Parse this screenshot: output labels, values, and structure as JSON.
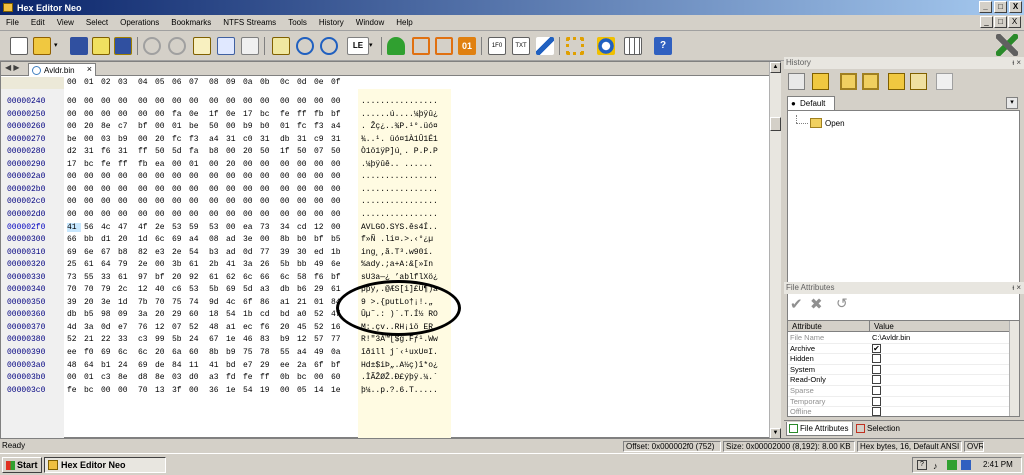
{
  "window": {
    "title": "Hex Editor Neo",
    "btn_min": "_",
    "btn_max": "□",
    "btn_close": "X"
  },
  "menu": [
    "File",
    "Edit",
    "View",
    "Select",
    "Operations",
    "Bookmarks",
    "NTFS Streams",
    "Tools",
    "History",
    "Window",
    "Help"
  ],
  "mdi_buttons": [
    "_",
    "□",
    "X"
  ],
  "toolbar": {
    "endian_label": "LE",
    "colors": {
      "green": "#2a9a2a",
      "orange": "#e07010",
      "blue": "#2060c0",
      "yellow": "#e0b000",
      "red": "#c02020"
    }
  },
  "editor": {
    "nav_arrows": "◀ ▶",
    "tab_label": "Avldr.bin",
    "tab_close": "×",
    "header": [
      "00",
      "01",
      "02",
      "03",
      "04",
      "05",
      "06",
      "07",
      "08",
      "09",
      "0a",
      "0b",
      "0c",
      "0d",
      "0e",
      "0f"
    ],
    "rows": [
      {
        "addr": "00000240",
        "hex": [
          "00",
          "00",
          "00",
          "00",
          "00",
          "00",
          "00",
          "00",
          "00",
          "00",
          "00",
          "00",
          "00",
          "00",
          "00",
          "00"
        ],
        "ascii": "................"
      },
      {
        "addr": "00000250",
        "hex": [
          "00",
          "00",
          "00",
          "00",
          "00",
          "00",
          "fa",
          "0e",
          "1f",
          "0e",
          "17",
          "bc",
          "fe",
          "ff",
          "fb",
          "bf"
        ],
        "ascii": "......ú....¼þÿû¿"
      },
      {
        "addr": "00000260",
        "hex": [
          "00",
          "20",
          "8e",
          "c7",
          "bf",
          "00",
          "01",
          "be",
          "50",
          "00",
          "b9",
          "b0",
          "01",
          "fc",
          "f3",
          "a4"
        ],
        "ascii": ". Žç¿..¾P.¹°.üó¤"
      },
      {
        "addr": "00000270",
        "hex": [
          "be",
          "00",
          "03",
          "b9",
          "00",
          "20",
          "fc",
          "f3",
          "a4",
          "31",
          "c0",
          "31",
          "db",
          "31",
          "c9",
          "31"
        ],
        "ascii": "¾..¹. üó¤1À1Û1É1"
      },
      {
        "addr": "00000280",
        "hex": [
          "d2",
          "31",
          "f6",
          "31",
          "ff",
          "50",
          "5d",
          "fa",
          "b8",
          "00",
          "20",
          "50",
          "1f",
          "50",
          "07",
          "50"
        ],
        "ascii": "Ò1ö1ÿP]ú¸. P.P.P"
      },
      {
        "addr": "00000290",
        "hex": [
          "17",
          "bc",
          "fe",
          "ff",
          "fb",
          "ea",
          "00",
          "01",
          "00",
          "20",
          "00",
          "00",
          "00",
          "00",
          "00",
          "00"
        ],
        "ascii": ".¼þÿûê.. ......"
      },
      {
        "addr": "000002a0",
        "hex": [
          "00",
          "00",
          "00",
          "00",
          "00",
          "00",
          "00",
          "00",
          "00",
          "00",
          "00",
          "00",
          "00",
          "00",
          "00",
          "00"
        ],
        "ascii": "................"
      },
      {
        "addr": "000002b0",
        "hex": [
          "00",
          "00",
          "00",
          "00",
          "00",
          "00",
          "00",
          "00",
          "00",
          "00",
          "00",
          "00",
          "00",
          "00",
          "00",
          "00"
        ],
        "ascii": "................"
      },
      {
        "addr": "000002c0",
        "hex": [
          "00",
          "00",
          "00",
          "00",
          "00",
          "00",
          "00",
          "00",
          "00",
          "00",
          "00",
          "00",
          "00",
          "00",
          "00",
          "00"
        ],
        "ascii": "................"
      },
      {
        "addr": "000002d0",
        "hex": [
          "00",
          "00",
          "00",
          "00",
          "00",
          "00",
          "00",
          "00",
          "00",
          "00",
          "00",
          "00",
          "00",
          "00",
          "00",
          "00"
        ],
        "ascii": "................"
      },
      {
        "addr": "000002f0",
        "hex": [
          "41",
          "56",
          "4c",
          "47",
          "4f",
          "2e",
          "53",
          "59",
          "53",
          "00",
          "ea",
          "73",
          "34",
          "cd",
          "12",
          "00"
        ],
        "ascii": "AVLGO.SYS.ês4Í.."
      },
      {
        "addr": "00000300",
        "hex": [
          "66",
          "bb",
          "d1",
          "20",
          "1d",
          "6c",
          "69",
          "a4",
          "08",
          "ad",
          "3e",
          "00",
          "8b",
          "b0",
          "bf",
          "b5"
        ],
        "ascii": "f»Ñ .li¤.­>.‹°¿µ"
      },
      {
        "addr": "00000310",
        "hex": [
          "69",
          "6e",
          "67",
          "b8",
          "82",
          "e3",
          "2e",
          "54",
          "b3",
          "ad",
          "0d",
          "77",
          "39",
          "30",
          "ed",
          "1b"
        ],
        "ascii": "ing¸‚ã.T³­.w90í."
      },
      {
        "addr": "00000320",
        "hex": [
          "25",
          "61",
          "64",
          "79",
          "2e",
          "00",
          "3b",
          "61",
          "2b",
          "41",
          "3a",
          "26",
          "5b",
          "bb",
          "49",
          "6e"
        ],
        "ascii": "%ady.;a+A:&[»In"
      },
      {
        "addr": "00000330",
        "hex": [
          "73",
          "55",
          "33",
          "61",
          "97",
          "bf",
          "20",
          "92",
          "61",
          "62",
          "6c",
          "66",
          "6c",
          "58",
          "f6",
          "bf"
        ],
        "ascii": "sU3a—¿ ’ablflXö¿"
      },
      {
        "addr": "00000340",
        "hex": [
          "70",
          "70",
          "79",
          "2c",
          "12",
          "40",
          "c6",
          "53",
          "5b",
          "69",
          "5d",
          "a3",
          "db",
          "b6",
          "29",
          "61"
        ],
        "ascii": "ppy,.@ÆS[i]£Û¶)a"
      },
      {
        "addr": "00000350",
        "hex": [
          "39",
          "20",
          "3e",
          "1d",
          "7b",
          "70",
          "75",
          "74",
          "9d",
          "4c",
          "6f",
          "86",
          "a1",
          "21",
          "01",
          "84"
        ],
        "ascii": "9 >.{putLo†¡!.„"
      },
      {
        "addr": "00000360",
        "hex": [
          "db",
          "b5",
          "98",
          "09",
          "3a",
          "20",
          "29",
          "60",
          "18",
          "54",
          "1b",
          "cd",
          "bd",
          "a0",
          "52",
          "4f"
        ],
        "ascii": "Ûµ˜.: )`.T.Í½ RO"
      },
      {
        "addr": "00000370",
        "hex": [
          "4d",
          "3a",
          "0d",
          "e7",
          "76",
          "12",
          "07",
          "52",
          "48",
          "a1",
          "ec",
          "f6",
          "20",
          "45",
          "52",
          "16"
        ],
        "ascii": "M:.çv..RH¡ìö ER."
      },
      {
        "addr": "00000380",
        "hex": [
          "52",
          "21",
          "22",
          "33",
          "c3",
          "99",
          "5b",
          "24",
          "67",
          "1e",
          "46",
          "83",
          "b9",
          "12",
          "57",
          "77"
        ],
        "ascii": "R!\"3Ã™[$g.Fƒ¹.Ww"
      },
      {
        "addr": "00000390",
        "hex": [
          "ee",
          "f0",
          "69",
          "6c",
          "6c",
          "20",
          "6a",
          "60",
          "8b",
          "b9",
          "75",
          "78",
          "55",
          "a4",
          "49",
          "0a"
        ],
        "ascii": "îðill j`‹¹uxU¤I."
      },
      {
        "addr": "000003a0",
        "hex": [
          "48",
          "64",
          "b1",
          "24",
          "69",
          "de",
          "84",
          "11",
          "41",
          "bd",
          "e7",
          "29",
          "ee",
          "2a",
          "6f",
          "bf"
        ],
        "ascii": "Hd±$iÞ„.A½ç)î*o¿"
      },
      {
        "addr": "000003b0",
        "hex": [
          "00",
          "01",
          "c3",
          "8e",
          "d8",
          "8e",
          "03",
          "d0",
          "a3",
          "fd",
          "fe",
          "ff",
          "0b",
          "bc",
          "00",
          "60"
        ],
        "ascii": ".ÌÃŽØŽ.Ð£ýþÿ.¼.`"
      },
      {
        "addr": "000003c0",
        "hex": [
          "fe",
          "bc",
          "00",
          "00",
          "70",
          "13",
          "3f",
          "00",
          "36",
          "1e",
          "54",
          "19",
          "00",
          "05",
          "14",
          "1e"
        ],
        "ascii": "þ¼..p.?.6.T....."
      }
    ]
  },
  "history": {
    "panel_title": "History",
    "pin": "ᵻ ×",
    "tab_label": "Default",
    "items": [
      "Open"
    ]
  },
  "file_attributes": {
    "panel_title": "File Attributes",
    "pin": "ᵻ ×",
    "col_attribute": "Attribute",
    "col_value": "Value",
    "rows": [
      {
        "name": "File Name",
        "value": "C:\\Avldr.bin",
        "type": "text",
        "gray": true
      },
      {
        "name": "Archive",
        "value": "✔",
        "type": "check",
        "gray": false
      },
      {
        "name": "Hidden",
        "value": "",
        "type": "check",
        "gray": false
      },
      {
        "name": "System",
        "value": "",
        "type": "check",
        "gray": false
      },
      {
        "name": "Read-Only",
        "value": "",
        "type": "check",
        "gray": false
      },
      {
        "name": "Sparse",
        "value": "",
        "type": "check",
        "gray": true
      },
      {
        "name": "Temporary",
        "value": "",
        "type": "check",
        "gray": true
      },
      {
        "name": "Offline",
        "value": "",
        "type": "check",
        "gray": true
      }
    ],
    "tabs": [
      "File Attributes",
      "Selection"
    ]
  },
  "status": {
    "ready": "Ready",
    "offset": "Offset: 0x000002f0 (752)",
    "size": "Size: 0x00002000 (8,192): 8.00 KB",
    "mode": "Hex bytes, 16, Default ANSI",
    "ovr": "OVR"
  },
  "taskbar": {
    "start": "Start",
    "app": "Hex Editor Neo",
    "clock": "2:41 PM"
  }
}
